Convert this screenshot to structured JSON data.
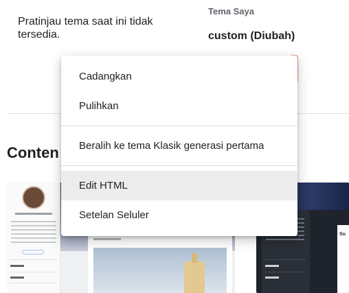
{
  "preview": {
    "message": "Pratinjau tema saat ini tidak tersedia."
  },
  "theme": {
    "label": "Tema Saya",
    "name": "custom (Diubah)"
  },
  "section": {
    "title": "Conten"
  },
  "menu": {
    "items": [
      {
        "label": "Cadangkan"
      },
      {
        "label": "Pulihkan"
      },
      {
        "label": "Beralih ke tema Klasik generasi pertama"
      },
      {
        "label": "Edit HTML",
        "highlighted": true
      },
      {
        "label": "Setelan Seluler"
      }
    ]
  },
  "gallery": {
    "second_thumb_text": "Su"
  },
  "colors": {
    "accent_edge": "#e8a38a",
    "menu_highlight": "#ececec",
    "divider": "#dadce0"
  }
}
